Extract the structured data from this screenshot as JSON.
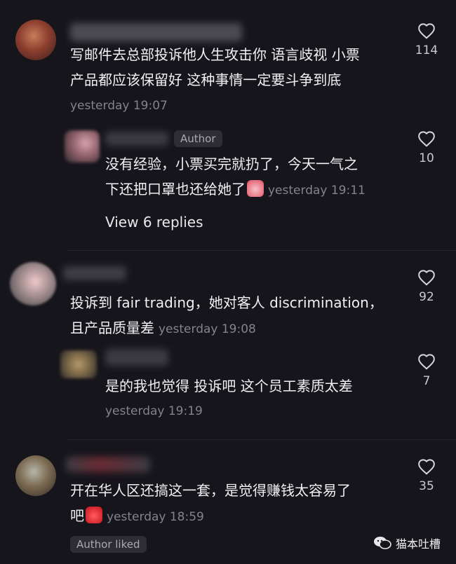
{
  "colors": {
    "background": "#16151b",
    "text": "#f1f1f3",
    "muted": "#83838b",
    "badge_bg": "#2d2d33"
  },
  "comments": [
    {
      "text_lines": [
        "写邮件去总部投诉他人生攻击你 语言歧视 小票",
        "产品都应该保留好 这种事情一定要斗争到底"
      ],
      "timestamp": "yesterday 19:07",
      "likes": "114"
    },
    {
      "badge": "Author",
      "text_lines": [
        "没有经验，小票买完就扔了，今天一气之",
        "下还把口罩也还给她了"
      ],
      "emoji": "pink-face-emoji",
      "timestamp": "yesterday 19:11",
      "likes": "10",
      "view_replies": "View 6 replies"
    },
    {
      "text_lines": [
        "投诉到 fair trading，她对客人 discrimination，",
        "且产品质量差"
      ],
      "timestamp": "yesterday 19:08",
      "likes": "92"
    },
    {
      "text_lines": [
        "是的我也觉得 投诉吧 这个员工素质太差"
      ],
      "timestamp": "yesterday 19:19",
      "likes": "7"
    },
    {
      "text_lines": [
        "开在华人区还搞这一套，是觉得赚钱太容易了",
        "吧"
      ],
      "emoji": "devil-face-emoji",
      "timestamp": "yesterday 18:59",
      "likes": "35",
      "author_liked": "Author liked"
    }
  ],
  "watermark": {
    "text": "猫本吐槽",
    "icon": "wechat-icon"
  }
}
